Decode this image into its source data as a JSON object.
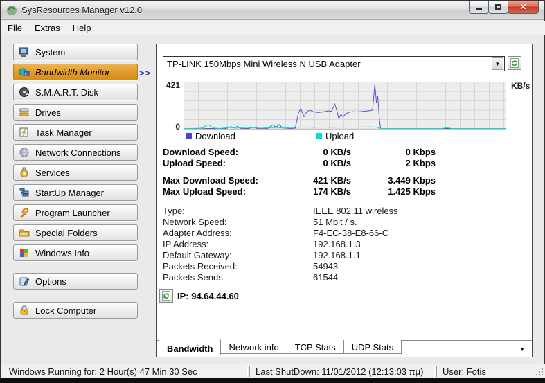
{
  "window": {
    "title": "SysResources Manager  v12.0"
  },
  "menu": {
    "items": [
      {
        "label": "File"
      },
      {
        "label": "Extras"
      },
      {
        "label": "Help"
      }
    ]
  },
  "sidebar": {
    "active_marker": ">>",
    "items": [
      {
        "label": "System",
        "icon": "computer-icon"
      },
      {
        "label": "Bandwidth Monitor",
        "icon": "bandwidth-icon",
        "active": true
      },
      {
        "label": "S.M.A.R.T. Disk",
        "icon": "disk-icon"
      },
      {
        "label": "Drives",
        "icon": "drives-icon"
      },
      {
        "label": "Task Manager",
        "icon": "task-manager-icon"
      },
      {
        "label": "Network Connections",
        "icon": "network-icon"
      },
      {
        "label": "Services",
        "icon": "services-icon"
      },
      {
        "label": "StartUp Manager",
        "icon": "startup-icon"
      },
      {
        "label": "Program Launcher",
        "icon": "launcher-icon"
      },
      {
        "label": "Special Folders",
        "icon": "folders-icon"
      },
      {
        "label": "Windows Info",
        "icon": "windows-icon"
      },
      {
        "label": "Options",
        "icon": "options-icon",
        "gap": 1
      },
      {
        "label": "Lock Computer",
        "icon": "lock-icon",
        "gap": 2
      }
    ]
  },
  "main": {
    "adapter_select": {
      "value": "TP-LINK 150Mbps Mini Wireless N USB Adapter"
    },
    "legend": [
      {
        "label": "Download",
        "color": "#4d44cc",
        "x": 0
      },
      {
        "label": "Upload",
        "color": "#00dede",
        "x": 188
      }
    ],
    "speed_rows": [
      {
        "label": "Download Speed:",
        "kbs": "0 KB/s",
        "kbps": "0 Kbps"
      },
      {
        "label": "Upload Speed:",
        "kbs": "0 KB/s",
        "kbps": "2 Kbps"
      },
      {
        "label": "Max Download Speed:",
        "kbs": "421 KB/s",
        "kbps": "3.449 Kbps",
        "gap": true
      },
      {
        "label": "Max Upload Speed:",
        "kbs": "174 KB/s",
        "kbps": "1.425 Kbps"
      }
    ],
    "info_rows": [
      {
        "label": "Type:",
        "value": "IEEE 802.11 wireless"
      },
      {
        "label": "Network Speed:",
        "value": "51 Mbit / s."
      },
      {
        "label": "Adapter Address:",
        "value": "F4-EC-38-E8-66-C"
      },
      {
        "label": "IP Address:",
        "value": "192.168.1.3"
      },
      {
        "label": "Default Gateway:",
        "value": "192.168.1.1"
      },
      {
        "label": "Packets Received:",
        "value": "54943"
      },
      {
        "label": "Packets Sends:",
        "value": "61544"
      }
    ],
    "public_ip": "IP: 94.64.44.60",
    "tabs": [
      {
        "label": "Bandwidth",
        "active": true
      },
      {
        "label": "Network info"
      },
      {
        "label": "TCP Stats"
      },
      {
        "label": "UDP Stats"
      }
    ]
  },
  "chart_data": {
    "type": "line",
    "title": "Bandwidth history",
    "unit": "KB/s",
    "ylim": [
      0,
      421
    ],
    "ytick_top": "421",
    "ytick_bottom": "0",
    "grid": true,
    "legend_position": "bottom",
    "series": [
      {
        "name": "Download",
        "color": "#5a52cc",
        "points": [
          [
            0,
            0
          ],
          [
            0.04,
            0
          ],
          [
            0.055,
            3
          ],
          [
            0.07,
            0
          ],
          [
            0.13,
            0
          ],
          [
            0.145,
            18
          ],
          [
            0.155,
            6
          ],
          [
            0.165,
            20
          ],
          [
            0.175,
            2
          ],
          [
            0.2,
            0
          ],
          [
            0.215,
            14
          ],
          [
            0.225,
            2
          ],
          [
            0.26,
            2
          ],
          [
            0.275,
            35
          ],
          [
            0.285,
            12
          ],
          [
            0.295,
            38
          ],
          [
            0.305,
            6
          ],
          [
            0.33,
            0
          ],
          [
            0.345,
            4
          ],
          [
            0.355,
            150
          ],
          [
            0.362,
            188
          ],
          [
            0.372,
            112
          ],
          [
            0.382,
            165
          ],
          [
            0.392,
            172
          ],
          [
            0.402,
            158
          ],
          [
            0.417,
            152
          ],
          [
            0.432,
            158
          ],
          [
            0.447,
            168
          ],
          [
            0.457,
            163
          ],
          [
            0.468,
            232
          ],
          [
            0.474,
            170
          ],
          [
            0.48,
            95
          ],
          [
            0.487,
            135
          ],
          [
            0.493,
            112
          ],
          [
            0.503,
            142
          ],
          [
            0.513,
            155
          ],
          [
            0.523,
            160
          ],
          [
            0.538,
            158
          ],
          [
            0.553,
            162
          ],
          [
            0.568,
            167
          ],
          [
            0.578,
            170
          ],
          [
            0.585,
            175
          ],
          [
            0.592,
            421
          ],
          [
            0.597,
            245
          ],
          [
            0.601,
            310
          ],
          [
            0.606,
            90
          ],
          [
            0.61,
            0
          ],
          [
            0.7,
            0
          ],
          [
            1,
            0
          ]
        ]
      },
      {
        "name": "Upload",
        "color": "#00dede",
        "points": [
          [
            0,
            0
          ],
          [
            0.05,
            2
          ],
          [
            0.075,
            36
          ],
          [
            0.09,
            6
          ],
          [
            0.11,
            0
          ],
          [
            0.14,
            10
          ],
          [
            0.16,
            4
          ],
          [
            0.19,
            12
          ],
          [
            0.21,
            6
          ],
          [
            0.24,
            14
          ],
          [
            0.26,
            6
          ],
          [
            0.29,
            10
          ],
          [
            0.31,
            4
          ],
          [
            0.34,
            12
          ],
          [
            0.37,
            14
          ],
          [
            0.4,
            12
          ],
          [
            0.43,
            14
          ],
          [
            0.46,
            12
          ],
          [
            0.49,
            14
          ],
          [
            0.52,
            13
          ],
          [
            0.55,
            14
          ],
          [
            0.58,
            15
          ],
          [
            0.6,
            12
          ],
          [
            0.61,
            0
          ],
          [
            0.8,
            0
          ],
          [
            0.815,
            8
          ],
          [
            0.83,
            0
          ],
          [
            1,
            0
          ]
        ]
      }
    ]
  },
  "statusbar": {
    "uptime": "Windows Running for: 2 Hour(s) 47 Min 30 Sec",
    "last_shutdown": "Last ShutDown: 11/01/2012 (12:13:03 πμ)",
    "user": "User: Fotis"
  }
}
